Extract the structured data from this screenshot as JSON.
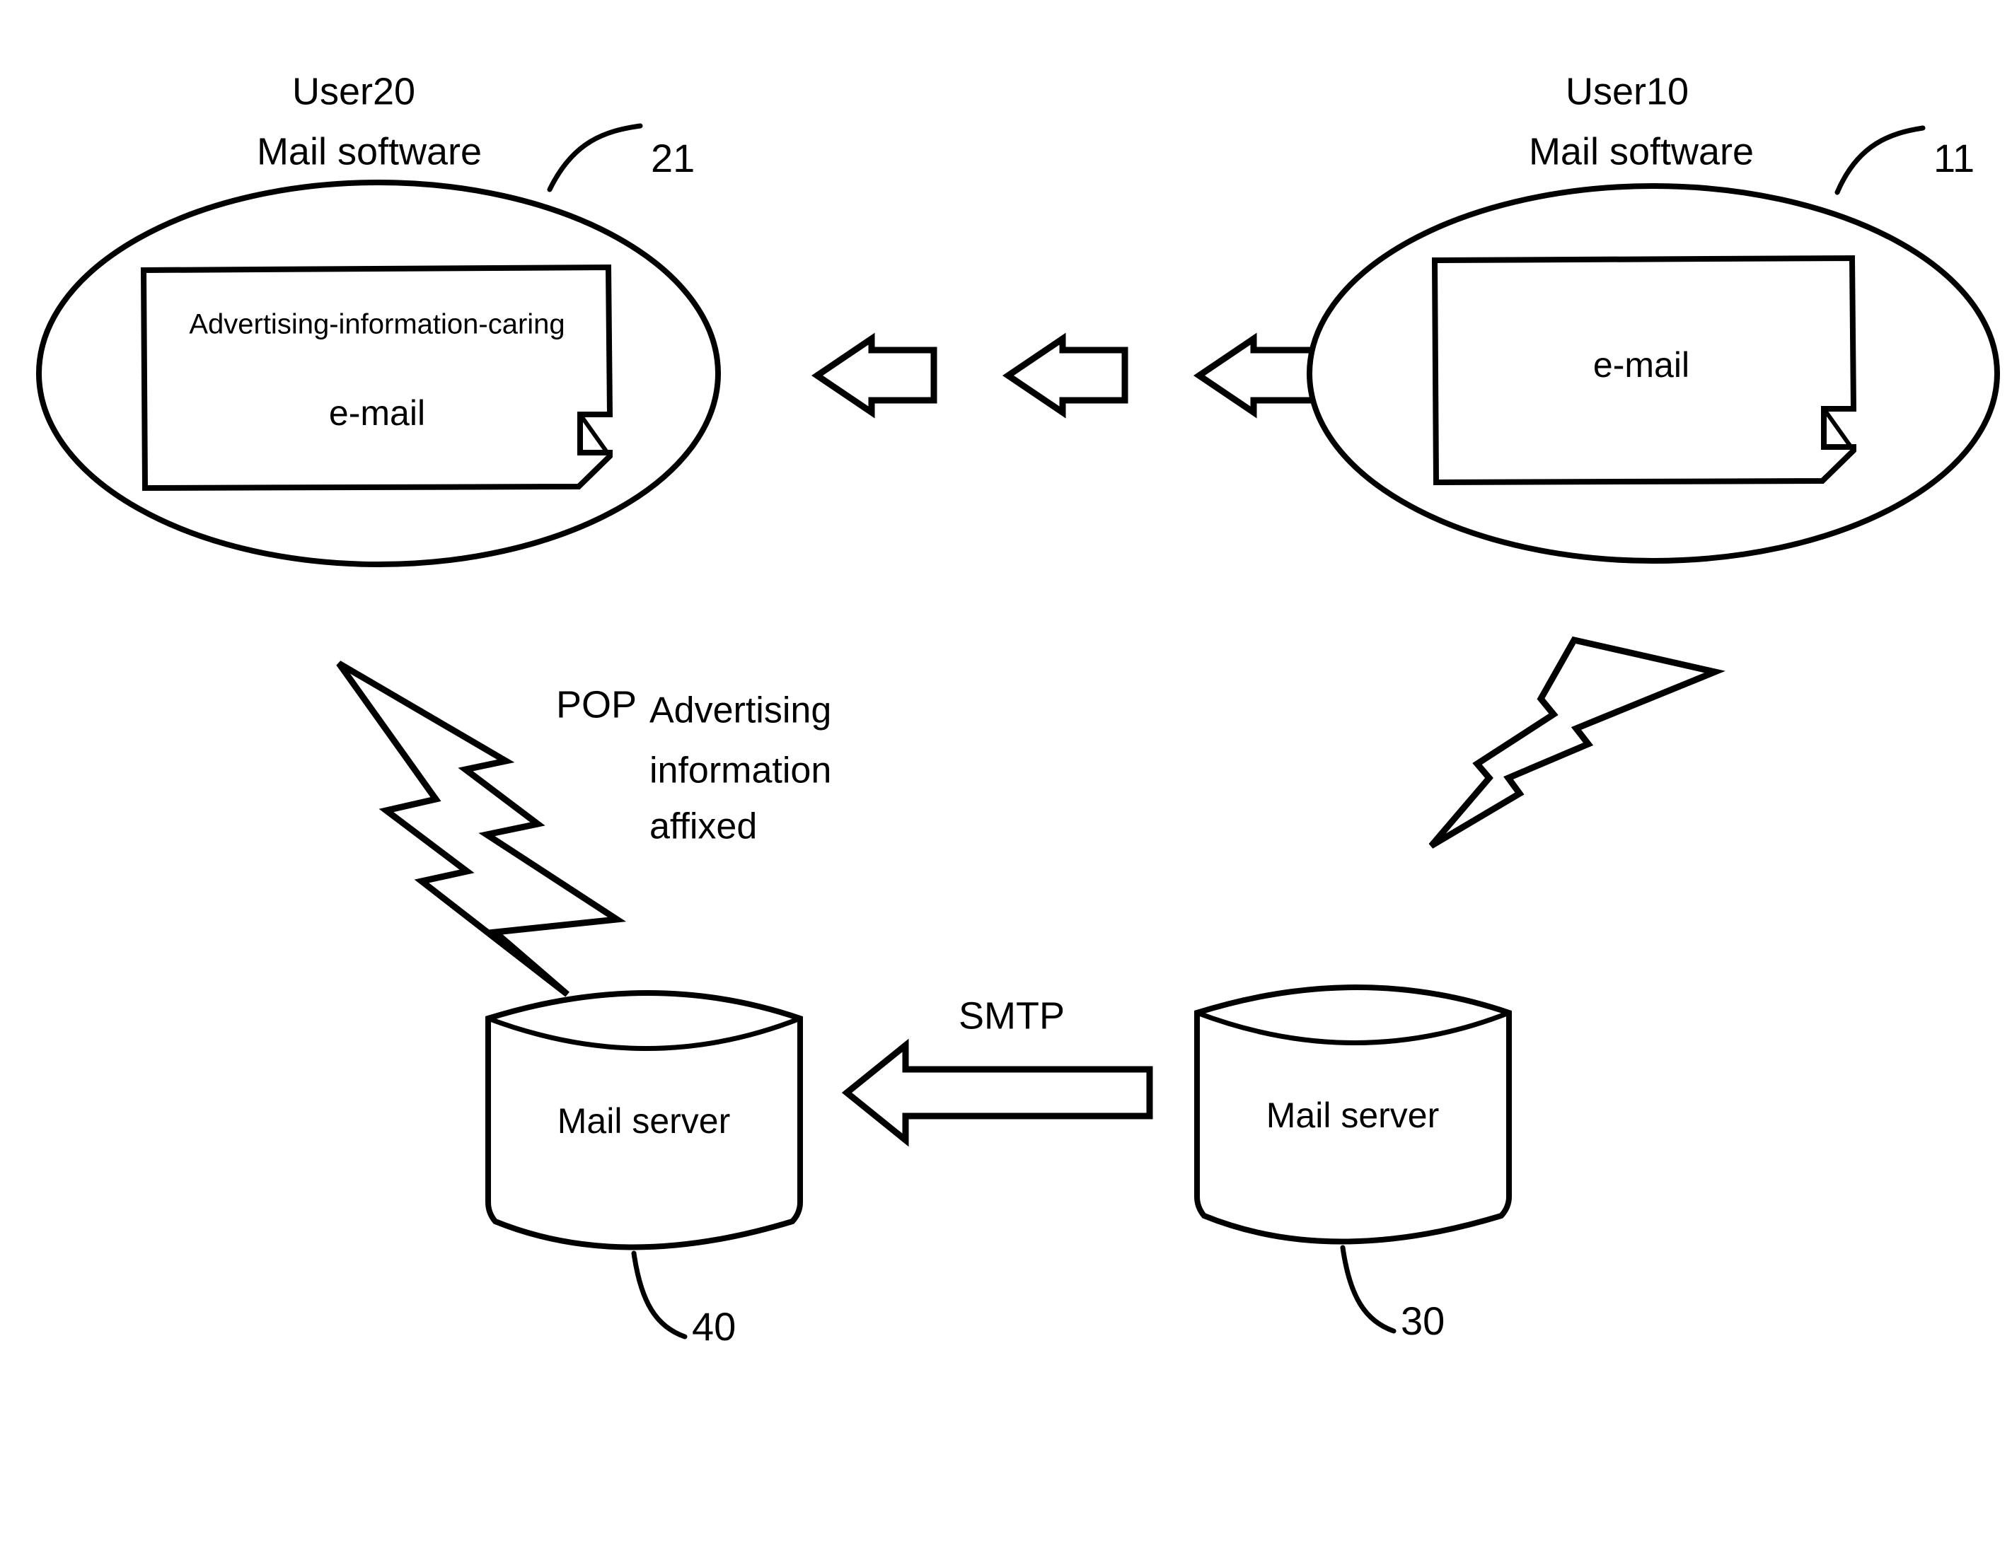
{
  "figure": {
    "title": "E-mail advertising information affixing system diagram",
    "background_color": "#ffffff",
    "line_color": "#000000"
  },
  "left_client": {
    "user_label": "User20",
    "software_label": "Mail software",
    "reference_number": "21",
    "document": {
      "line1": "Advertising-information-caring",
      "line2": "e-mail"
    }
  },
  "right_client": {
    "user_label": "User10",
    "software_label": "Mail software",
    "reference_number": "11",
    "document": {
      "line1": "e-mail"
    }
  },
  "transfer_arrows": {
    "count": 3,
    "direction": "right-to-left"
  },
  "pop_link": {
    "protocol_label": "POP",
    "note_line1": "Advertising",
    "note_line2": "information",
    "note_line3": "affixed"
  },
  "smtp_link": {
    "protocol_label": "SMTP",
    "direction": "right-to-left"
  },
  "left_server": {
    "label": "Mail server",
    "reference_number": "40"
  },
  "right_server": {
    "label": "Mail server",
    "reference_number": "30"
  }
}
